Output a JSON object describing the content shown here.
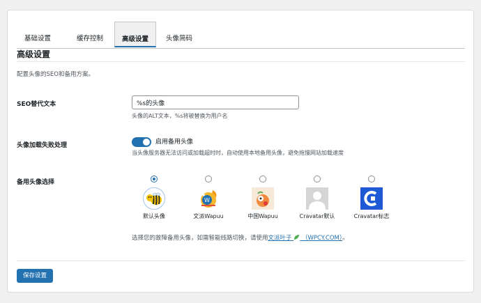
{
  "tabs": [
    {
      "label": "基础设置"
    },
    {
      "label": "缓存控制"
    },
    {
      "label": "高级设置"
    },
    {
      "label": "头像简码"
    }
  ],
  "active_tab": 2,
  "section": {
    "title": "高级设置",
    "description": "配置头像的SEO和备用方案。"
  },
  "seo": {
    "label": "SEO替代文本",
    "value": "%s的头像",
    "hint": "头像的ALT文本，%s将被替换为用户名"
  },
  "fallback": {
    "label": "头像加载失败处理",
    "toggle_label": "启用备用头像",
    "toggle_on": true,
    "hint": "当头像服务器无法访问或加载超时时，自动使用本地备用头像，避免拖慢网站加载速度"
  },
  "backup": {
    "label": "备用头像选择",
    "options": [
      {
        "label": "默认头像",
        "selected": true,
        "icon": "bee-avatar-icon"
      },
      {
        "label": "文派Wapuu",
        "selected": false,
        "icon": "wapuu-avatar-icon"
      },
      {
        "label": "中国Wapuu",
        "selected": false,
        "icon": "china-wapuu-avatar-icon"
      },
      {
        "label": "Cravatar默认",
        "selected": false,
        "icon": "default-person-avatar-icon"
      },
      {
        "label": "Cravatar标志",
        "selected": false,
        "icon": "cravatar-logo-icon"
      }
    ],
    "note_prefix": "选择您的故障备用头像，如需智能线路切换，请使用",
    "note_link": "文派叶子",
    "note_link_suffix": "（WPCY.COM）",
    "note_suffix": "。"
  },
  "save_label": "保存设置",
  "colors": {
    "accent": "#2271b1",
    "border": "#c3c4c7",
    "background": "#f0f0f1"
  }
}
